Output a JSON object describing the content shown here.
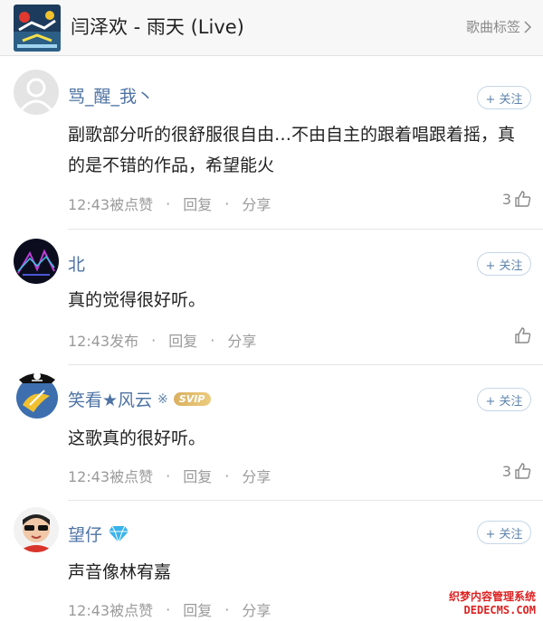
{
  "header": {
    "song_title": "闫泽欢 - 雨天 (Live)",
    "tag_label": "歌曲标签",
    "album_icon": "album-cover"
  },
  "comments": [
    {
      "username": "骂_醒_我丶",
      "follow_label": "+ 关注",
      "content": "副歌部分听的很舒服很自由…不由自主的跟着唱跟着摇，真的是不错的作品，希望能火",
      "time_text": "12:43被点赞",
      "reply_label": "回复",
      "share_label": "分享",
      "like_count": "3"
    },
    {
      "username": "北",
      "follow_label": "+ 关注",
      "content": "真的觉得很好听。",
      "time_text": "12:43发布",
      "reply_label": "回复",
      "share_label": "分享",
      "like_count": ""
    },
    {
      "username": "笑看★风云",
      "vip_mark": "※",
      "badge": "SVIP",
      "follow_label": "+ 关注",
      "content": "这歌真的很好听。",
      "time_text": "12:43被点赞",
      "reply_label": "回复",
      "share_label": "分享",
      "like_count": "3"
    },
    {
      "username": "望仔",
      "follow_label": "+ 关注",
      "content": "声音像林宥嘉",
      "time_text": "12:43被点赞",
      "reply_label": "回复",
      "share_label": "分享",
      "like_count": ""
    }
  ],
  "watermark": {
    "line1": "织梦内容管理系统",
    "line2": "DEDECMS.COM"
  },
  "colors": {
    "username": "#4e73a5",
    "follow_border": "#c6d6e6",
    "meta": "#9a9a9a",
    "svip": "#d9b060"
  }
}
